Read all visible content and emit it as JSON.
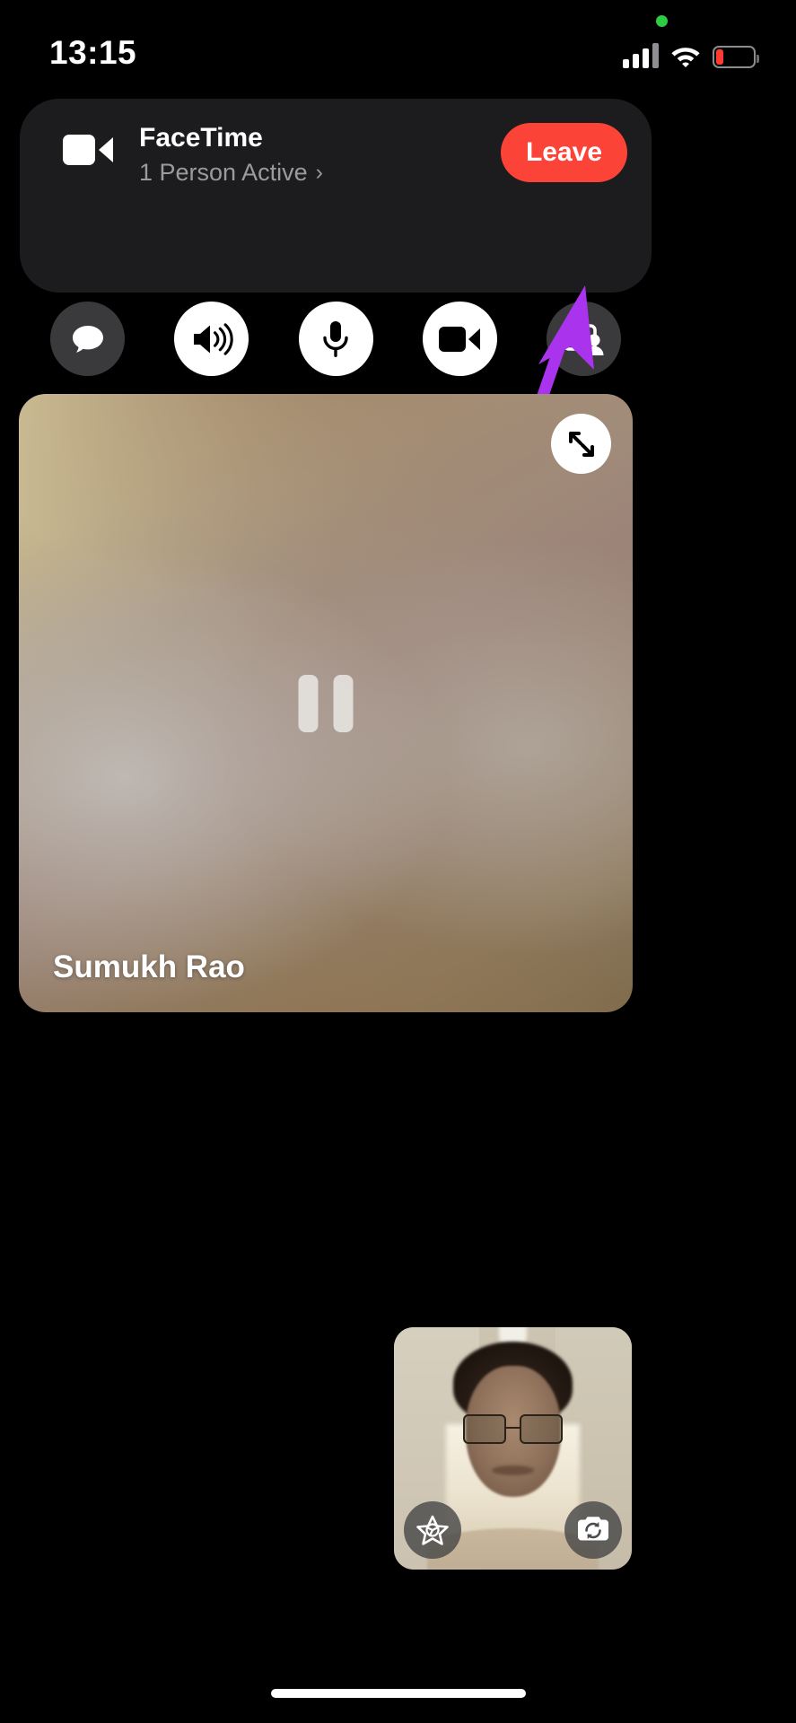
{
  "status_bar": {
    "time": "13:15",
    "recording_indicator": "green-dot",
    "cellular_icon": "cellular-bars-icon",
    "cellular_bars_filled": 3,
    "wifi_icon": "wifi-icon",
    "battery_icon": "battery-low-icon",
    "battery_color": "#FF3B30"
  },
  "facetime_banner": {
    "app_icon": "video-camera-icon",
    "title": "FaceTime",
    "subtitle": "1 Person Active",
    "subtitle_chevron": "›",
    "leave_label": "Leave",
    "leave_color": "#FC4337",
    "background_color": "#1C1C1E",
    "controls": [
      {
        "name": "messages-button",
        "icon": "chat-bubble-icon",
        "style": "dark"
      },
      {
        "name": "speaker-button",
        "icon": "speaker-wave-icon",
        "style": "light"
      },
      {
        "name": "microphone-button",
        "icon": "microphone-icon",
        "style": "light"
      },
      {
        "name": "camera-button",
        "icon": "video-camera-icon",
        "style": "light"
      },
      {
        "name": "shareplay-button",
        "icon": "share-screen-person-icon",
        "style": "dark"
      }
    ]
  },
  "annotation": {
    "arrow": "purple-arrow-pointing-to-shareplay-button",
    "arrow_color": "#AA33EE"
  },
  "main_video": {
    "participant_name": "Sumukh Rao",
    "state_icon": "pause-icon",
    "expand_icon": "expand-arrows-icon"
  },
  "self_view": {
    "effects_icon": "effects-star-icon",
    "flip_camera_icon": "camera-flip-icon"
  },
  "home_indicator": "home-indicator-bar"
}
